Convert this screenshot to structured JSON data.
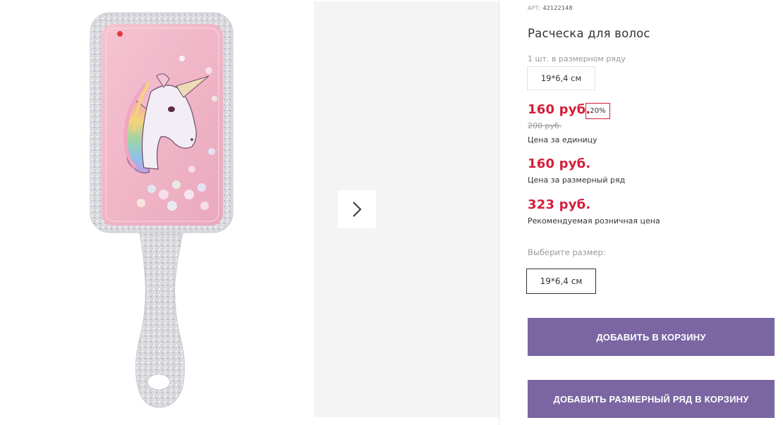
{
  "product": {
    "sku_label": "АРТ:",
    "sku_value": "42122148",
    "title": "Расческа для волос",
    "pack_note": "1 шт. в размерном ряду",
    "pack_size": "19*6,4 см"
  },
  "prices": {
    "unit_price": "160 руб.",
    "discount": "20%",
    "old_price": "200 руб.",
    "unit_caption": "Цена за единицу",
    "row_price": "160 руб.",
    "row_caption": "Цена за размерный ряд",
    "rrp_price": "323 руб.",
    "rrp_caption": "Рекомендуемая розничная цена"
  },
  "size_selector": {
    "label": "Выберите размер:",
    "options": [
      "19*6,4 см"
    ]
  },
  "actions": {
    "add_to_cart": "ДОБАВИТЬ В КОРЗИНУ",
    "add_row_to_cart": "ДОБАВИТЬ РАЗМЕРНЫЙ РЯД В КОРЗИНУ"
  },
  "colors": {
    "accent_price": "#d41f3a",
    "button": "#7b66a3"
  },
  "icons": {
    "next": "chevron-right-icon"
  }
}
